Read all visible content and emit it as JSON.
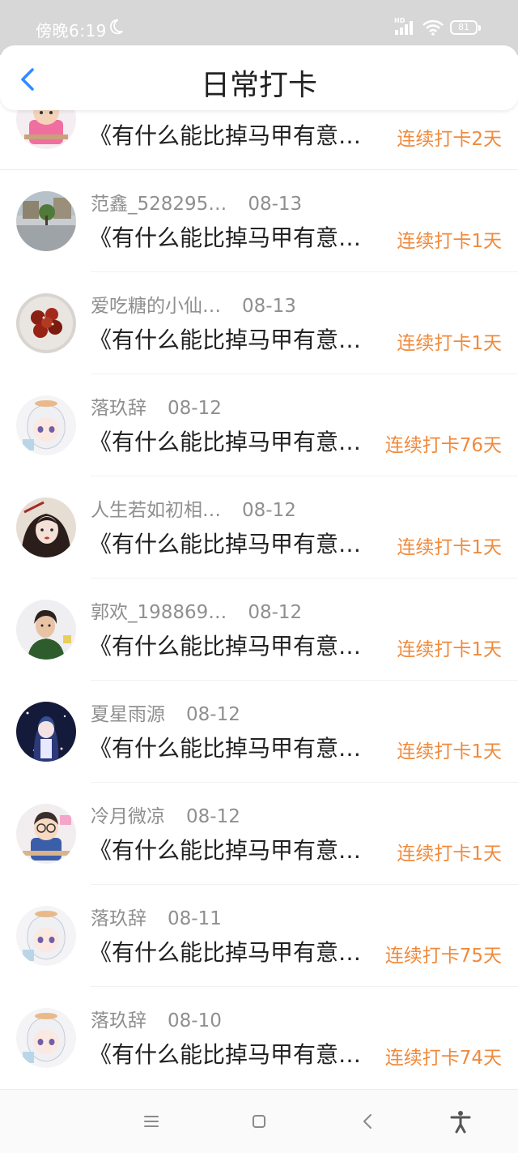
{
  "status_bar": {
    "time": "傍晚6:19",
    "network": "HD",
    "battery": "81"
  },
  "header": {
    "title": "日常打卡"
  },
  "colors": {
    "accent": "#f08a3c",
    "back": "#2f8cff",
    "meta": "#8f8f8f"
  },
  "records": [
    {
      "user": "",
      "date": "",
      "title": "《有什么能比掉马甲有意…",
      "streak": "连续打卡2天",
      "avatar": "cartoon-boy-pink"
    },
    {
      "user": "范鑫_528295…",
      "date": "08-13",
      "title": "《有什么能比掉马甲有意…",
      "streak": "连续打卡1天",
      "avatar": "street-photo"
    },
    {
      "user": "爱吃糖的小仙…",
      "date": "08-13",
      "title": "《有什么能比掉马甲有意…",
      "streak": "连续打卡1天",
      "avatar": "food-plate"
    },
    {
      "user": "落玖辞",
      "date": "08-12",
      "title": "《有什么能比掉马甲有意…",
      "streak": "连续打卡76天",
      "avatar": "anime-white-hair"
    },
    {
      "user": "人生若如初相…",
      "date": "08-12",
      "title": "《有什么能比掉马甲有意…",
      "streak": "连续打卡1天",
      "avatar": "painted-woman"
    },
    {
      "user": "郭欢_198869…",
      "date": "08-12",
      "title": "《有什么能比掉马甲有意…",
      "streak": "连续打卡1天",
      "avatar": "woman-photo"
    },
    {
      "user": "夏星雨源",
      "date": "08-12",
      "title": "《有什么能比掉马甲有意…",
      "streak": "连续打卡1天",
      "avatar": "anime-night-sky"
    },
    {
      "user": "冷月微凉",
      "date": "08-12",
      "title": "《有什么能比掉马甲有意…",
      "streak": "连续打卡1天",
      "avatar": "cartoon-detective"
    },
    {
      "user": "落玖辞",
      "date": "08-11",
      "title": "《有什么能比掉马甲有意…",
      "streak": "连续打卡75天",
      "avatar": "anime-white-hair"
    },
    {
      "user": "落玖辞",
      "date": "08-10",
      "title": "《有什么能比掉马甲有意…",
      "streak": "连续打卡74天",
      "avatar": "anime-white-hair"
    }
  ],
  "nav_bar": {
    "icons": [
      "menu-icon",
      "home-icon",
      "back-icon",
      "accessibility-icon"
    ]
  }
}
